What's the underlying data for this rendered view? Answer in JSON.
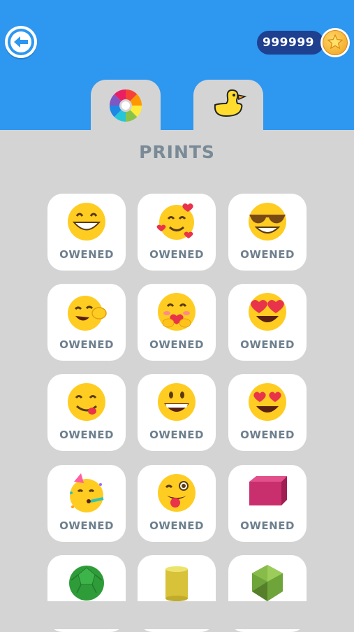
{
  "header": {
    "coin_balance": "999999",
    "back_icon": "back-arrow-icon",
    "coin_icon": "star-coin-icon"
  },
  "tabs": [
    {
      "name": "color-wheel-icon"
    },
    {
      "name": "duck-icon"
    }
  ],
  "section_title": "PRINTS",
  "items": [
    {
      "icon": "grinning-emoji-icon",
      "status": "OWENED"
    },
    {
      "icon": "smiling-hearts-emoji-icon",
      "status": "OWENED"
    },
    {
      "icon": "sunglasses-emoji-icon",
      "status": "OWENED"
    },
    {
      "icon": "winking-hand-emoji-icon",
      "status": "OWENED"
    },
    {
      "icon": "hugging-emoji-icon",
      "status": "OWENED"
    },
    {
      "icon": "heart-glasses-emoji-icon",
      "status": "OWENED"
    },
    {
      "icon": "yum-emoji-icon",
      "status": "OWENED"
    },
    {
      "icon": "big-smile-emoji-icon",
      "status": "OWENED"
    },
    {
      "icon": "heart-eyes-emoji-icon",
      "status": "OWENED"
    },
    {
      "icon": "party-emoji-icon",
      "status": "OWENED"
    },
    {
      "icon": "wink-tongue-emoji-icon",
      "status": "OWENED"
    },
    {
      "icon": "pink-cube-icon",
      "status": "OWENED"
    },
    {
      "icon": "green-ball-icon",
      "status": ""
    },
    {
      "icon": "yellow-cylinder-icon",
      "status": ""
    },
    {
      "icon": "green-polyhedron-icon",
      "status": ""
    }
  ],
  "colors": {
    "header_blue": "#2e97f0",
    "coin_pill": "#1f3f8f",
    "label_gray": "#6d7f8d",
    "background": "#d4d4d4"
  }
}
